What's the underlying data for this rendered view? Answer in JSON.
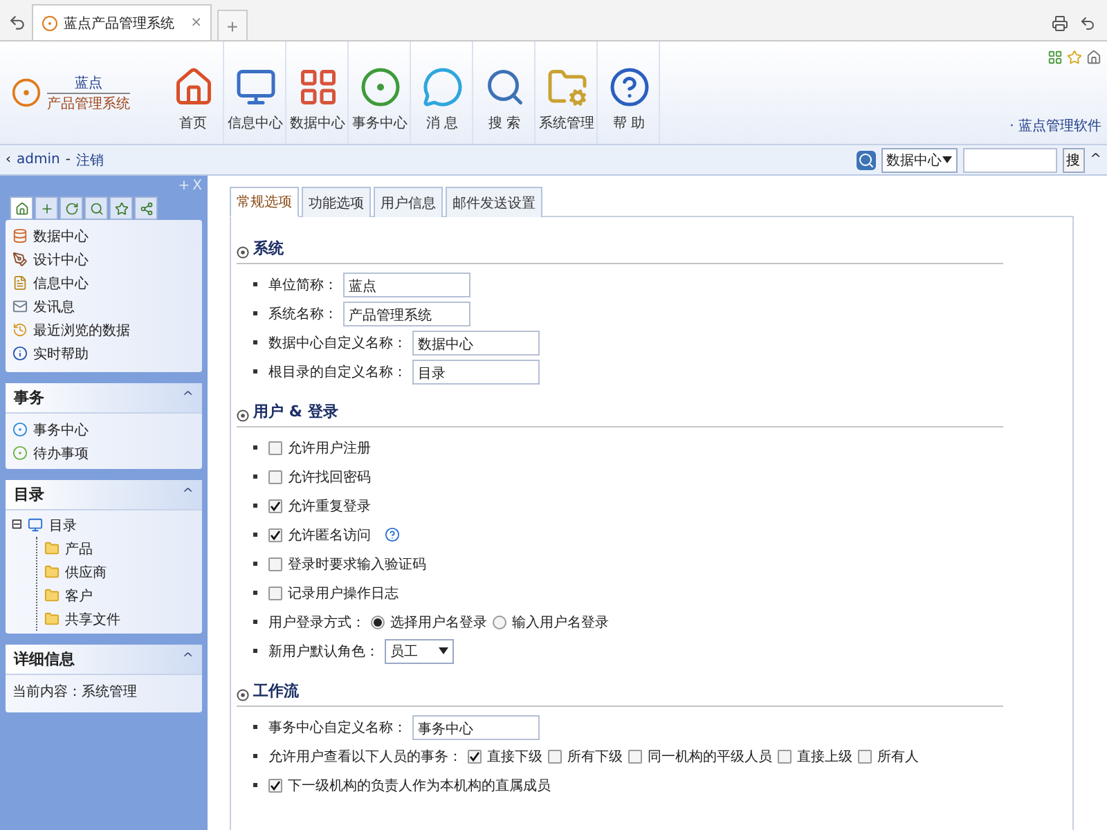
{
  "browser_tab": {
    "title": "蓝点产品管理系统",
    "close": "×",
    "new_tab": "+"
  },
  "logo": {
    "line1": "蓝点",
    "line2": "产品管理系统"
  },
  "toolbar": [
    {
      "label": "首页"
    },
    {
      "label": "信息中心"
    },
    {
      "label": "数据中心"
    },
    {
      "label": "事务中心"
    },
    {
      "label": "消 息"
    },
    {
      "label": "搜 索"
    },
    {
      "label": "系统管理"
    },
    {
      "label": "帮 助"
    }
  ],
  "brand_link": "· 蓝点管理软件",
  "nav": {
    "back": "‹",
    "user": "admin",
    "separator": "-",
    "logout": "注销",
    "search_scope": "数据中心",
    "search_button": "搜",
    "collapse": "^"
  },
  "sidebar": {
    "controls": [
      "+",
      "X"
    ],
    "icon_tabs": [
      {
        "selected": true
      },
      {
        "selected": false
      },
      {
        "selected": false
      },
      {
        "selected": false
      },
      {
        "selected": false
      },
      {
        "selected": false
      }
    ],
    "quick_links": [
      {
        "label": "数据中心"
      },
      {
        "label": "设计中心"
      },
      {
        "label": "信息中心"
      },
      {
        "label": "发讯息"
      },
      {
        "label": "最近浏览的数据"
      },
      {
        "label": "实时帮助"
      }
    ],
    "panels": [
      {
        "kind": "list",
        "title": "事务",
        "toggle": "^",
        "items": [
          {
            "label": "事务中心"
          },
          {
            "label": "待办事项"
          }
        ]
      },
      {
        "kind": "tree",
        "title": "目录",
        "toggle": "^",
        "root": {
          "label": "目录",
          "expander": "⊟",
          "children": [
            {
              "label": "产品"
            },
            {
              "label": "供应商"
            },
            {
              "label": "客户"
            },
            {
              "label": "共享文件"
            }
          ]
        }
      },
      {
        "kind": "text",
        "title": "详细信息",
        "toggle": "^",
        "text": "当前内容：系统管理"
      }
    ]
  },
  "content": {
    "tabs": [
      {
        "label": "常规选项",
        "selected": true
      },
      {
        "label": "功能选项",
        "selected": false
      },
      {
        "label": "用户信息",
        "selected": false
      },
      {
        "label": "邮件发送设置",
        "selected": false
      }
    ],
    "sections": [
      {
        "title": "系统",
        "rows": [
          {
            "kind": "text",
            "label": "单位简称：",
            "value": "蓝点"
          },
          {
            "kind": "text",
            "label": "系统名称：",
            "value": "产品管理系统"
          },
          {
            "kind": "text",
            "label": "数据中心自定义名称：",
            "value": "数据中心"
          },
          {
            "kind": "text",
            "label": "根目录的自定义名称：",
            "value": "目录"
          }
        ]
      },
      {
        "title": "用户 & 登录",
        "rows": [
          {
            "kind": "checkbox",
            "label": "允许用户注册",
            "checked": false,
            "help": false
          },
          {
            "kind": "checkbox",
            "label": "允许找回密码",
            "checked": false,
            "help": false
          },
          {
            "kind": "checkbox",
            "label": "允许重复登录",
            "checked": true,
            "help": false
          },
          {
            "kind": "checkbox",
            "label": "允许匿名访问",
            "checked": true,
            "help": true
          },
          {
            "kind": "checkbox",
            "label": "登录时要求输入验证码",
            "checked": false,
            "help": false
          },
          {
            "kind": "checkbox",
            "label": "记录用户操作日志",
            "checked": false,
            "help": false
          },
          {
            "kind": "radio",
            "label": "用户登录方式：",
            "options": [
              {
                "label": "选择用户名登录",
                "selected": true
              },
              {
                "label": "输入用户名登录",
                "selected": false
              }
            ]
          },
          {
            "kind": "select",
            "label": "新用户默认角色：",
            "value": "员工"
          }
        ]
      },
      {
        "title": "工作流",
        "rows": [
          {
            "kind": "text",
            "label": "事务中心自定义名称：",
            "value": "事务中心"
          },
          {
            "kind": "checkgroup",
            "label": "允许用户查看以下人员的事务：",
            "options": [
              {
                "label": "直接下级",
                "checked": true
              },
              {
                "label": "所有下级",
                "checked": false
              },
              {
                "label": "同一机构的平级人员",
                "checked": false
              },
              {
                "label": "直接上级",
                "checked": false
              },
              {
                "label": "所有人",
                "checked": false
              }
            ]
          },
          {
            "kind": "checkbox",
            "label": "下一级机构的负责人作为本机构的直属成员",
            "checked": true,
            "help": false
          }
        ]
      }
    ]
  }
}
